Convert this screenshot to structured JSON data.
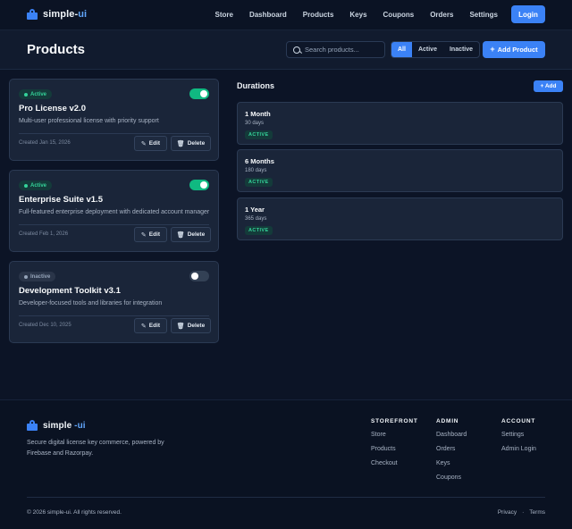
{
  "nav": {
    "brand_prefix": "simple-",
    "brand_accent": "ui",
    "links": [
      "Store",
      "Dashboard",
      "Products",
      "Keys",
      "Coupons",
      "Orders",
      "Settings"
    ],
    "login_label": "Login"
  },
  "header": {
    "title": "Products",
    "search_placeholder": "Search products...",
    "filters": [
      "All",
      "Active",
      "Inactive"
    ],
    "selected_filter": "All",
    "add_product_label": "Add Product"
  },
  "products": [
    {
      "status": "Active",
      "enabled": true,
      "name": "Pro License v2.0",
      "description": "Multi-user professional license with priority support",
      "created": "Created Jan 15, 2026"
    },
    {
      "status": "Active",
      "enabled": true,
      "name": "Enterprise Suite v1.5",
      "description": "Full-featured enterprise deployment with dedicated account manager",
      "created": "Created Feb 1, 2026"
    },
    {
      "status": "Inactive",
      "enabled": false,
      "name": "Development Toolkit v3.1",
      "description": "Developer-focused tools and libraries for integration",
      "created": "Created Dec 10, 2025"
    }
  ],
  "product_actions": {
    "edit": "Edit",
    "delete": "Delete"
  },
  "durations": {
    "title": "Durations",
    "add_label": "+ Add",
    "items": [
      {
        "name": "1 Month",
        "days": "30 days",
        "status": "ACTIVE"
      },
      {
        "name": "6 Months",
        "days": "180 days",
        "status": "ACTIVE"
      },
      {
        "name": "1 Year",
        "days": "365 days",
        "status": "ACTIVE"
      }
    ]
  },
  "footer": {
    "brand_prefix": "simple",
    "brand_accent": "-ui",
    "tagline": "Secure digital license key commerce, powered by Firebase and Razorpay.",
    "columns": [
      {
        "heading": "STOREFRONT",
        "links": [
          "Store",
          "Products",
          "Checkout"
        ]
      },
      {
        "heading": "ADMIN",
        "links": [
          "Dashboard",
          "Orders",
          "Keys",
          "Coupons"
        ]
      },
      {
        "heading": "ACCOUNT",
        "links": [
          "Settings",
          "Admin Login"
        ]
      }
    ],
    "copyright": "© 2026 simple-ui. All rights reserved.",
    "legal": [
      "Privacy",
      "·",
      "Terms"
    ]
  },
  "colors": {
    "accent": "#3b82f6",
    "success": "#10b981",
    "background": "#0c1426"
  },
  "icons": {
    "brand": "shopping-bag-icon",
    "search": "search-icon",
    "edit": "pencil-icon",
    "delete": "trash-icon",
    "add": "plus-icon"
  }
}
